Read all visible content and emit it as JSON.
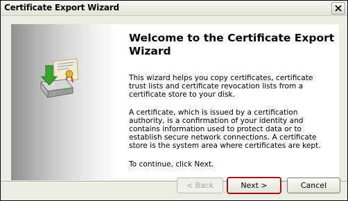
{
  "window": {
    "title": "Certificate Export Wizard",
    "close_icon": "close-icon"
  },
  "banner": {
    "icon": "certificate-export-icon"
  },
  "content": {
    "heading": "Welcome to the Certificate Export Wizard",
    "paragraph1": "This wizard helps you copy certificates, certificate trust lists and certificate revocation lists from a certificate store to your disk.",
    "paragraph2": "A certificate, which is issued by a certification authority, is a confirmation of your identity and contains information used to protect data or to establish secure network connections. A certificate store is the system area where certificates are kept.",
    "paragraph3": "To continue, click Next."
  },
  "buttons": {
    "back": "< Back",
    "next": "Next >",
    "cancel": "Cancel"
  },
  "colors": {
    "next_highlight": "#c21010",
    "window_background": "#ecece4"
  }
}
